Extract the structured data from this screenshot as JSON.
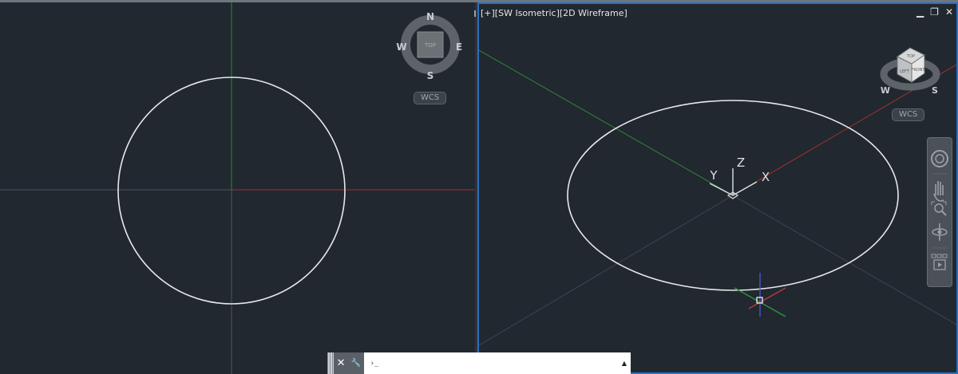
{
  "left_viewport": {
    "viewcube": {
      "face_label": "TOP",
      "north": "N",
      "south": "S",
      "east": "E",
      "west": "W"
    },
    "ucs_label": "WCS"
  },
  "right_viewport": {
    "label": "[+][SW Isometric][2D Wireframe]",
    "controls": {
      "minimize": "▁",
      "restore": "❐",
      "close": "✕"
    },
    "viewcube": {
      "faces": [
        "TOP",
        "LEFT",
        "FRONT"
      ],
      "west": "W",
      "south": "S"
    },
    "ucs_label": "WCS",
    "ucs_icon": {
      "x": "X",
      "y": "Y",
      "z": "Z"
    }
  },
  "navigation_bar": {
    "tools": [
      "steering-wheel-icon",
      "pan-icon",
      "zoom-extents-icon",
      "orbit-icon",
      "showmotion-icon"
    ]
  },
  "command_line": {
    "close_icon": "✕",
    "customize_icon": "🔧",
    "prompt_icon": "›_",
    "input_value": "",
    "input_placeholder": "",
    "recent_arrow": "▲"
  },
  "colors": {
    "background": "#212830",
    "x_axis": "#a03030",
    "y_axis": "#2f8a35",
    "active_border": "#2b6fc0"
  }
}
